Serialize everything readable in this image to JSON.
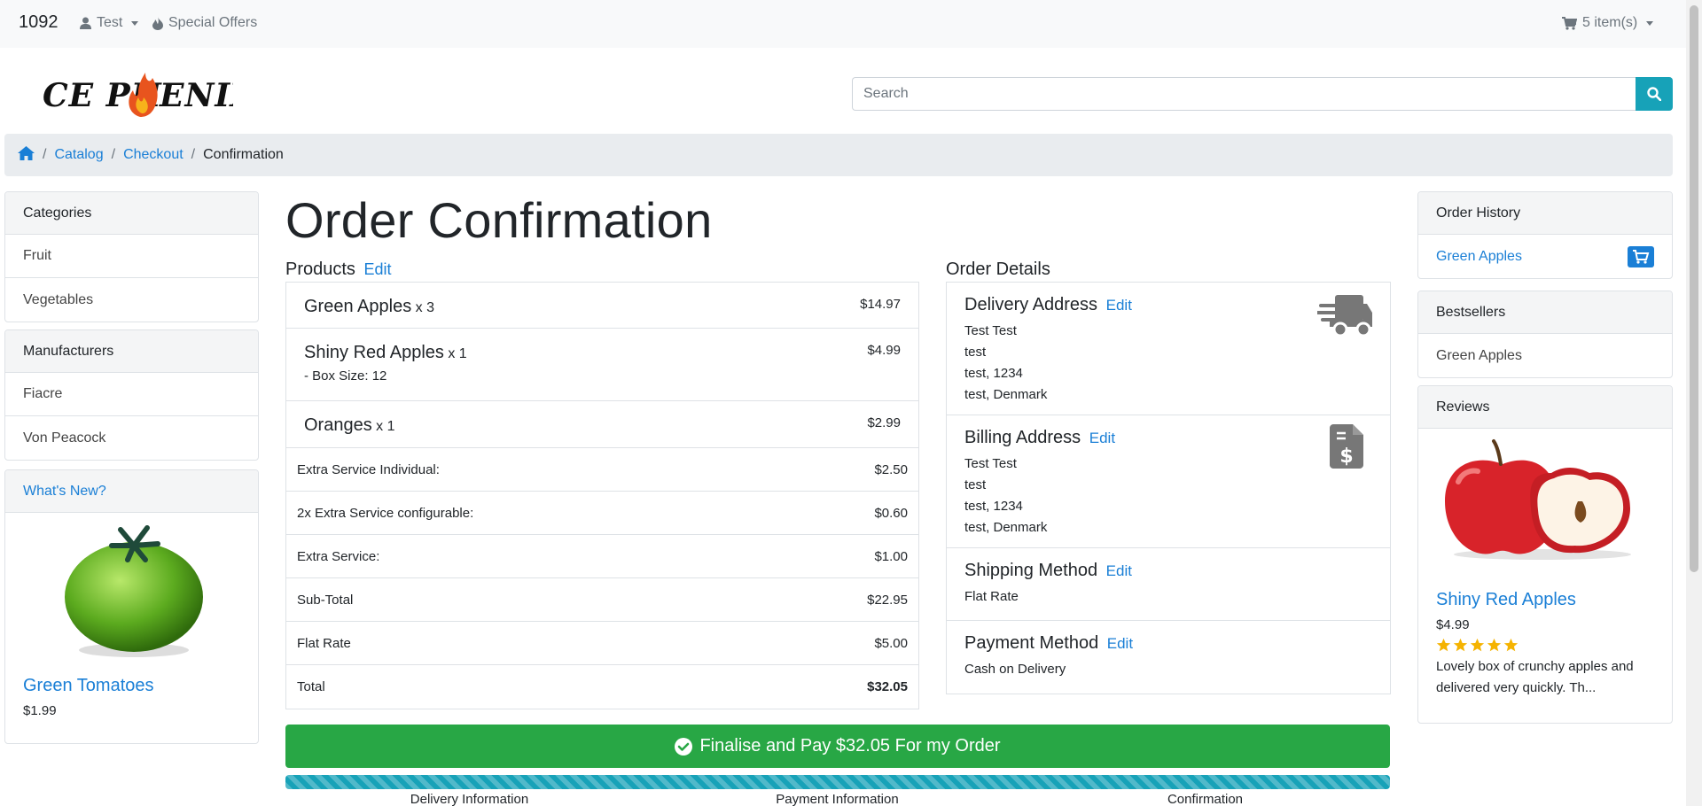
{
  "topnav": {
    "brand": "1092",
    "account_label": "Test",
    "offers_label": "Special Offers",
    "cart_label": "5 item(s)"
  },
  "header": {
    "logo_text": "CE PHOENIX",
    "search_placeholder": "Search"
  },
  "breadcrumb": {
    "items": [
      "Catalog",
      "Checkout"
    ],
    "current": "Confirmation"
  },
  "categories": {
    "title": "Categories",
    "items": [
      "Fruit",
      "Vegetables"
    ]
  },
  "manufacturers": {
    "title": "Manufacturers",
    "items": [
      "Fiacre",
      "Von Peacock"
    ]
  },
  "whats_new": {
    "title": "What's New?",
    "product_name": "Green Tomatoes",
    "price": "$1.99"
  },
  "main": {
    "title": "Order Confirmation",
    "products_title": "Products",
    "edit_label": "Edit",
    "products": [
      {
        "name": "Green Apples",
        "qty": "x 3",
        "price": "$14.97",
        "option": ""
      },
      {
        "name": "Shiny Red Apples",
        "qty": "x 1",
        "price": "$4.99",
        "option": "- Box Size: 12"
      },
      {
        "name": "Oranges",
        "qty": "x 1",
        "price": "$2.99",
        "option": ""
      }
    ],
    "totals": [
      {
        "label": "Extra Service Individual:",
        "value": "$2.50"
      },
      {
        "label": "2x Extra Service configurable:",
        "value": "$0.60"
      },
      {
        "label": "Extra Service:",
        "value": "$1.00"
      },
      {
        "label": "Sub-Total",
        "value": "$22.95"
      },
      {
        "label": "Flat Rate",
        "value": "$5.00"
      },
      {
        "label": "Total",
        "value": "$32.05"
      }
    ],
    "order_details_title": "Order Details",
    "delivery": {
      "title": "Delivery Address",
      "lines": [
        "Test Test",
        "test",
        "test, 1234",
        "test, Denmark"
      ]
    },
    "billing": {
      "title": "Billing Address",
      "lines": [
        "Test Test",
        "test",
        "test, 1234",
        "test, Denmark"
      ]
    },
    "shipping": {
      "title": "Shipping Method",
      "value": "Flat Rate"
    },
    "payment": {
      "title": "Payment Method",
      "value": "Cash on Delivery"
    },
    "finalise_label": "Finalise and Pay $32.05 For my Order",
    "progress_fraction": 1.0,
    "steps": [
      "Delivery Information",
      "Payment Information",
      "Confirmation"
    ]
  },
  "order_history": {
    "title": "Order History",
    "item": "Green Apples"
  },
  "bestsellers": {
    "title": "Bestsellers",
    "item": "Green Apples"
  },
  "reviews": {
    "title": "Reviews",
    "product_name": "Shiny Red Apples",
    "price": "$4.99",
    "rating": 5,
    "rating_max": 5,
    "text": "Lovely box of crunchy apples and delivered very quickly. Th..."
  },
  "colors": {
    "link": "#1a7fd6",
    "success": "#28a745",
    "info": "#17a2b8",
    "star": "#f5b301"
  }
}
